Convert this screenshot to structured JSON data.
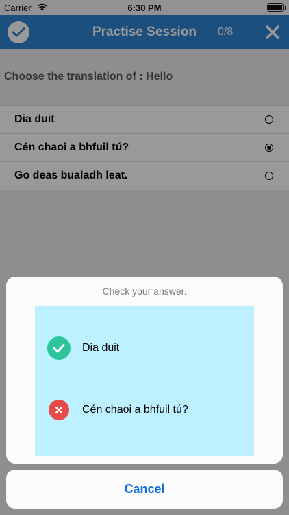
{
  "status": {
    "carrier": "Carrier",
    "time": "6:30 PM"
  },
  "nav": {
    "title": "Practise Session",
    "progress": "0/8"
  },
  "question": "Choose the translation of : Hello",
  "options": [
    {
      "label": "Dia duit",
      "selected": false
    },
    {
      "label": "Cén chaoi a bhfuil tú?",
      "selected": true
    },
    {
      "label": "Go deas bualadh leat.",
      "selected": false
    }
  ],
  "sheet": {
    "title": "Check your answer.",
    "correct_answer": "Dia duit",
    "your_answer": "Cén chaoi a bhfuil tú?",
    "cancel_label": "Cancel"
  },
  "colors": {
    "nav": "#2f84d0",
    "correct": "#2ec49b",
    "wrong": "#e84a4a",
    "answer_bg": "#bdf1ff",
    "cancel_text": "#0f6fe0"
  },
  "icons": [
    "wifi-icon",
    "battery-icon",
    "check-circle-icon",
    "close-icon",
    "correct-check-icon",
    "wrong-x-icon"
  ]
}
